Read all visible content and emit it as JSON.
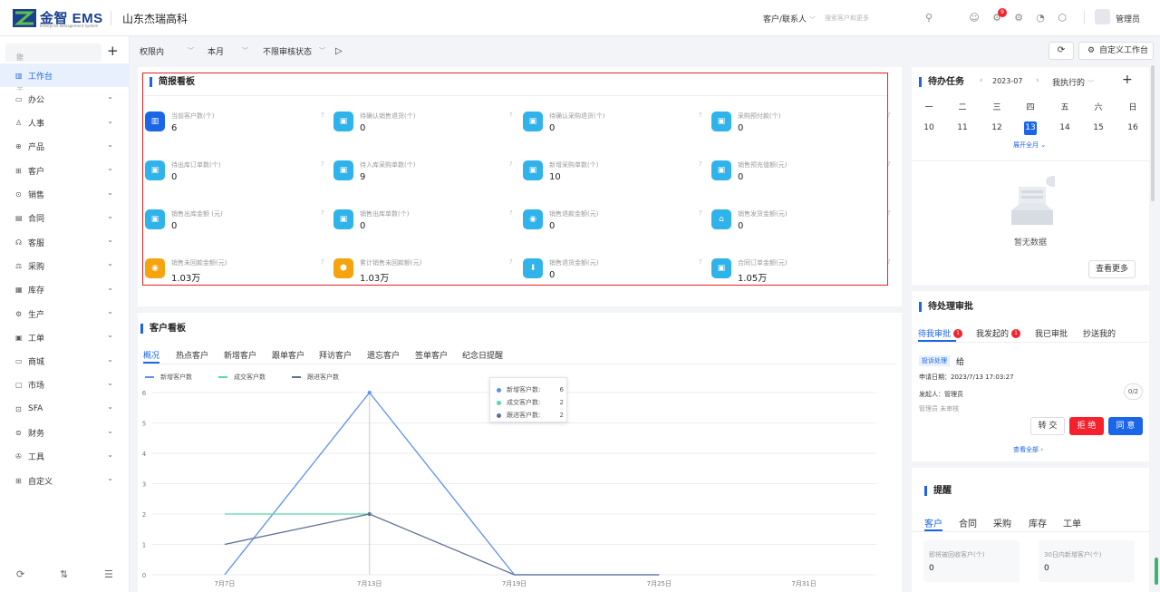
{
  "header": {
    "logo_text": "金智 EMS",
    "logo_sub": "Enterprise Management System",
    "company": "山东杰瑞高科",
    "customer_selector": "客户/联系人",
    "customer_search_placeholder": "搜索客户和更多",
    "notification_count": "9",
    "user_name": "管理员"
  },
  "sidebar": {
    "search_placeholder": "搜索菜单",
    "items": [
      {
        "label": "工作台",
        "icon": "dashboard-icon",
        "active": true
      },
      {
        "label": "办公",
        "icon": "office-icon"
      },
      {
        "label": "人事",
        "icon": "person-icon"
      },
      {
        "label": "产品",
        "icon": "product-icon"
      },
      {
        "label": "客户",
        "icon": "customer-icon"
      },
      {
        "label": "销售",
        "icon": "sales-icon"
      },
      {
        "label": "合同",
        "icon": "contract-icon"
      },
      {
        "label": "客服",
        "icon": "service-icon"
      },
      {
        "label": "采购",
        "icon": "purchase-icon"
      },
      {
        "label": "库存",
        "icon": "inventory-icon"
      },
      {
        "label": "生产",
        "icon": "production-icon"
      },
      {
        "label": "工单",
        "icon": "workorder-icon"
      },
      {
        "label": "商城",
        "icon": "shop-icon"
      },
      {
        "label": "市场",
        "icon": "market-icon"
      },
      {
        "label": "SFA",
        "icon": "sfa-icon"
      },
      {
        "label": "财务",
        "icon": "finance-icon"
      },
      {
        "label": "工具",
        "icon": "tool-icon"
      },
      {
        "label": "自定义",
        "icon": "custom-icon"
      }
    ]
  },
  "filters": {
    "scope": "权限内",
    "period": "本月",
    "audit": "不限审核状态",
    "refresh_label": "",
    "custom_workspace": "自定义工作台"
  },
  "brief": {
    "title": "简报看板",
    "stats": [
      {
        "label": "当前客户数(个)",
        "value": "6",
        "color": "#1a66e6"
      },
      {
        "label": "待确认销售退货(个)",
        "value": "0",
        "color": "#2fb3ea"
      },
      {
        "label": "待确认采购退货(个)",
        "value": "0",
        "color": "#2fb3ea"
      },
      {
        "label": "采购预付款(个)",
        "value": "0",
        "color": "#2fb3ea"
      },
      {
        "label": "待出库订单数(个)",
        "value": "0",
        "color": "#2fb3ea"
      },
      {
        "label": "待入库采购单数(个)",
        "value": "9",
        "color": "#2fb3ea"
      },
      {
        "label": "新增采购单数(个)",
        "value": "10",
        "color": "#2fb3ea"
      },
      {
        "label": "销售预充值额(元)",
        "value": "0",
        "color": "#2fb3ea"
      },
      {
        "label": "销售出库金额 (元)",
        "value": "0",
        "color": "#2fb3ea"
      },
      {
        "label": "销售出库单数(个)",
        "value": "0",
        "color": "#2fb3ea"
      },
      {
        "label": "销售退款金额(元)",
        "value": "0",
        "color": "#2fb3ea"
      },
      {
        "label": "销售发货金额(元)",
        "value": "0",
        "color": "#2fb3ea"
      },
      {
        "label": "销售未回款金额(元)",
        "value": "1.03万",
        "color": "#f5a30f"
      },
      {
        "label": "累计销售未回款额(元)",
        "value": "1.03万",
        "color": "#f5a30f"
      },
      {
        "label": "销售退货金额(元)",
        "value": "0",
        "color": "#2fb3ea"
      },
      {
        "label": "合同订单金额(元)",
        "value": "1.05万",
        "color": "#2fb3ea"
      }
    ]
  },
  "customer_panel": {
    "title": "客户看板",
    "tabs": [
      "概况",
      "热点客户",
      "新增客户",
      "跟单客户",
      "拜访客户",
      "遗忘客户",
      "签单客户",
      "纪念日提醒"
    ],
    "tooltip": {
      "rows": [
        {
          "label": "新增客户数:",
          "value": "6"
        },
        {
          "label": "成交客户数:",
          "value": "2"
        },
        {
          "label": "跟进客户数:",
          "value": "2"
        }
      ]
    }
  },
  "chart_data": {
    "type": "line",
    "x": [
      "7月7日",
      "7月13日",
      "7月19日",
      "7月25日",
      "7月31日"
    ],
    "ylim": [
      0,
      6
    ],
    "yticks": [
      0,
      1,
      2,
      3,
      4,
      5,
      6
    ],
    "grid": true,
    "legend_position": "top-left",
    "series": [
      {
        "name": "新增客户数",
        "color": "#5b8ff9",
        "values": [
          0,
          6,
          0,
          0,
          null
        ]
      },
      {
        "name": "成交客户数",
        "color": "#5ad8a6",
        "values": [
          2,
          2,
          null,
          null,
          null
        ]
      },
      {
        "name": "跟进客户数",
        "color": "#5d7092",
        "values": [
          1,
          2,
          0,
          0,
          null
        ]
      }
    ]
  },
  "todo": {
    "title": "待办任务",
    "month": "2023-07",
    "mine": "我执行的",
    "weekdays": [
      "一",
      "二",
      "三",
      "四",
      "五",
      "六",
      "日"
    ],
    "days": [
      "10",
      "11",
      "12",
      "13",
      "14",
      "15",
      "16"
    ],
    "today_index": 3,
    "expand": "展开全月",
    "empty_text": "暂无数据",
    "more": "查看更多"
  },
  "approval": {
    "title": "待处理审批",
    "tabs": [
      {
        "label": "待我审批",
        "badge": "1"
      },
      {
        "label": "我发起的",
        "badge": "1"
      },
      {
        "label": "我已审批",
        "badge": ""
      },
      {
        "label": "抄送我的",
        "badge": ""
      }
    ],
    "tag": "投诉处理",
    "item_title": "给",
    "date_line": "申请日期：2023/7/13 17:03:27",
    "initiator_line": "发起人：管理员",
    "status_line": "管理员 未审核",
    "count": "0/2",
    "btn_transfer": "转 交",
    "btn_reject": "拒 绝",
    "btn_approve": "同 意",
    "view_all": "查看全部"
  },
  "reminder": {
    "title": "提醒",
    "tabs": [
      "客户",
      "合同",
      "采购",
      "库存",
      "工单"
    ],
    "boxes": [
      {
        "label": "即将被回收客户(个)",
        "value": "0"
      },
      {
        "label": "30日内新增客户(个)",
        "value": "0"
      }
    ]
  }
}
